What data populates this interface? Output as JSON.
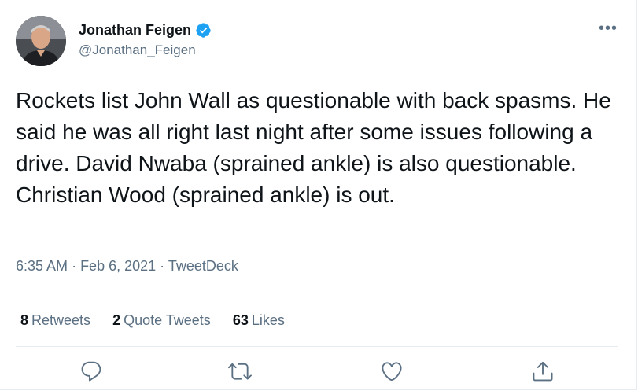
{
  "author": {
    "display_name": "Jonathan Feigen",
    "handle": "@Jonathan_Feigen",
    "verified": true,
    "avatar_icon": "profile-photo"
  },
  "tweet": {
    "text": "Rockets list John Wall as questionable with back spasms. He said he was all right last night after some issues following a drive. David Nwaba (sprained ankle) is also questionable. Christian Wood (sprained ankle) is out.",
    "time": "6:35 AM",
    "date": "Feb 6, 2021",
    "source": "TweetDeck"
  },
  "stats": {
    "retweets_count": "8",
    "retweets_label": "Retweets",
    "quotes_count": "2",
    "quotes_label": "Quote Tweets",
    "likes_count": "63",
    "likes_label": "Likes"
  },
  "more_label": "•••",
  "actions": [
    "reply-icon",
    "retweet-icon",
    "like-icon",
    "share-icon"
  ],
  "colors": {
    "text_primary": "#0f1419",
    "text_secondary": "#5b7083",
    "verified_blue": "#1da1f2",
    "divider": "#e6ecf0"
  }
}
